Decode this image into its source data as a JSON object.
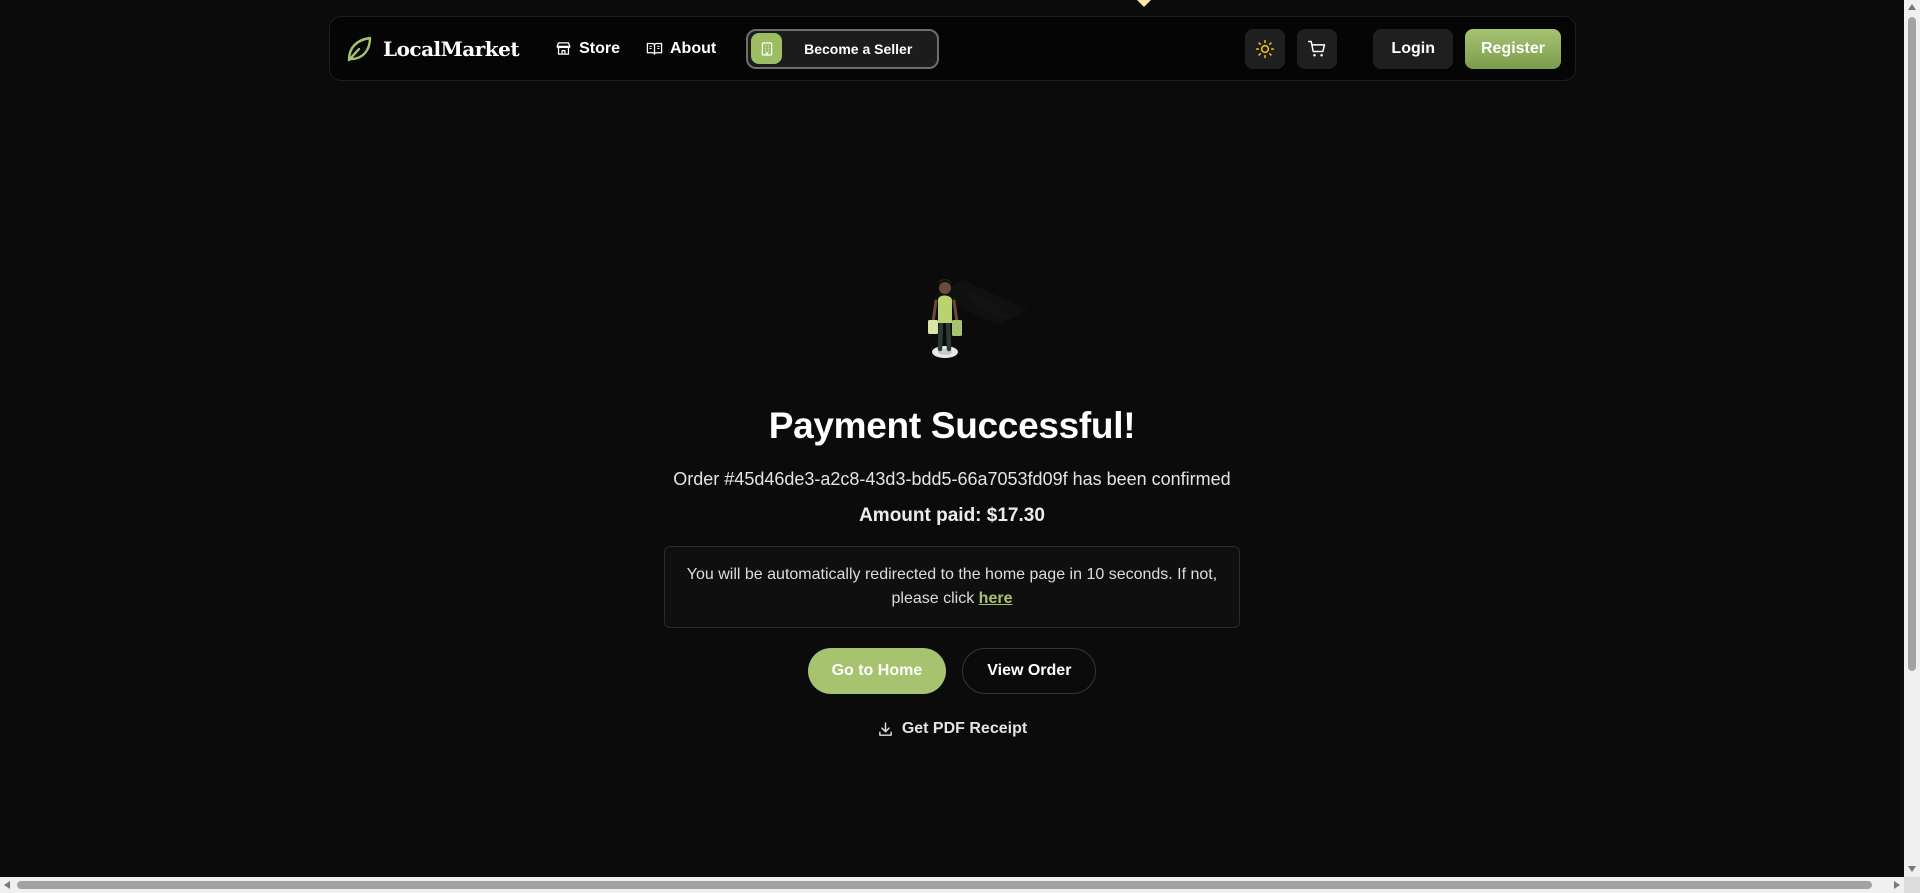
{
  "nav": {
    "brand": "LocalMarket",
    "links": [
      {
        "label": "Store",
        "icon": "store-icon"
      },
      {
        "label": "About",
        "icon": "book-open-icon"
      }
    ],
    "seller_button": "Become a Seller",
    "theme_icon": "sun-icon",
    "cart_icon": "cart-icon",
    "login": "Login",
    "register": "Register"
  },
  "main": {
    "title": "Payment Successful!",
    "order_line": "Order #45d46de3-a2c8-43d3-bdd5-66a7053fd09f has been confirmed",
    "amount_line": "Amount paid: $17.30",
    "notice_text": "You will be automatically redirected to the home page in 10 seconds. If not, please click ",
    "notice_link": "here",
    "home_button": "Go to Home",
    "view_order_button": "View Order",
    "pdf_link": "Get PDF Receipt"
  },
  "colors": {
    "accent": "#a7c36f",
    "background": "#0b0b0b",
    "theme_icon": "#f5c518"
  }
}
